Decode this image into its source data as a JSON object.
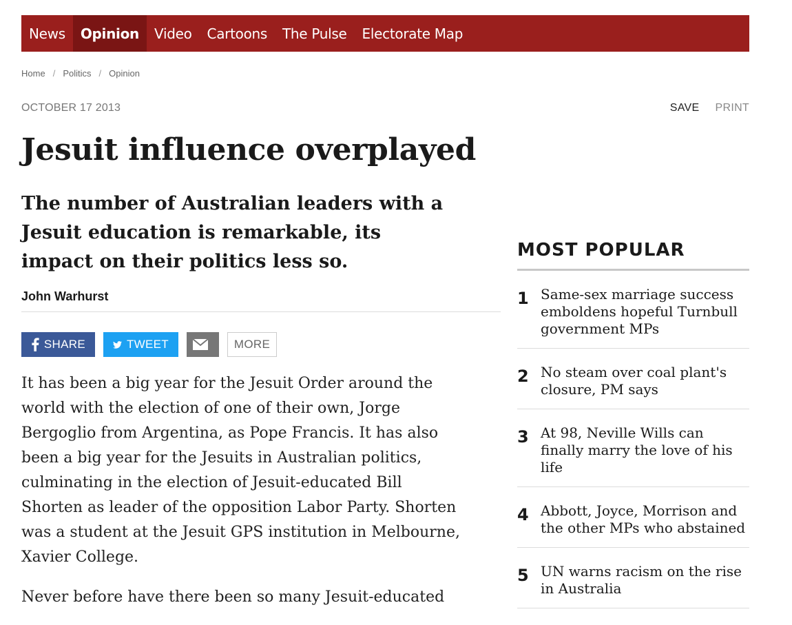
{
  "nav": {
    "items": [
      {
        "label": "News",
        "active": false
      },
      {
        "label": "Opinion",
        "active": true
      },
      {
        "label": "Video",
        "active": false
      },
      {
        "label": "Cartoons",
        "active": false
      },
      {
        "label": "The Pulse",
        "active": false
      },
      {
        "label": "Electorate Map",
        "active": false
      }
    ],
    "bg_color": "#9a1f1d"
  },
  "breadcrumb": [
    "Home",
    "Politics",
    "Opinion"
  ],
  "breadcrumb_separator": "/",
  "article": {
    "date": "OCTOBER 17 2013",
    "headline": "Jesuit influence overplayed",
    "standfirst": "The number of Australian leaders with a Jesuit education is remarkable, its impact on their politics less so.",
    "author": "John Warhurst",
    "paragraphs": [
      "It has been a big year for the Jesuit Order around the world with the election of one of their own, Jorge Bergoglio from Argentina, as Pope Francis. It has also been a big year for the Jesuits in Australian politics, culminating in the election of Jesuit-educated Bill Shorten as leader of the opposition Labor Party. Shorten was a student at the Jesuit GPS institution in Melbourne, Xavier College.",
      "Never before have there been so many Jesuit-educated"
    ]
  },
  "tools": {
    "save": "SAVE",
    "print": "PRINT"
  },
  "share": {
    "facebook": {
      "label": "SHARE",
      "icon": "facebook-icon",
      "color": "#3b5998"
    },
    "twitter": {
      "label": "TWEET",
      "icon": "twitter-icon",
      "color": "#1da1f2"
    },
    "email": {
      "icon": "email-icon",
      "color": "#777777"
    },
    "more": {
      "label": "MORE"
    }
  },
  "most_popular": {
    "title": "MOST POPULAR",
    "items": [
      {
        "rank": "1",
        "title": "Same-sex marriage success emboldens hopeful Turnbull government MPs"
      },
      {
        "rank": "2",
        "title": "No steam over coal plant's closure, PM says"
      },
      {
        "rank": "3",
        "title": "At 98, Neville Wills can finally marry the love of his life"
      },
      {
        "rank": "4",
        "title": "Abbott, Joyce, Morrison and the other MPs who abstained"
      },
      {
        "rank": "5",
        "title": "UN warns racism on the rise in Australia"
      }
    ]
  }
}
